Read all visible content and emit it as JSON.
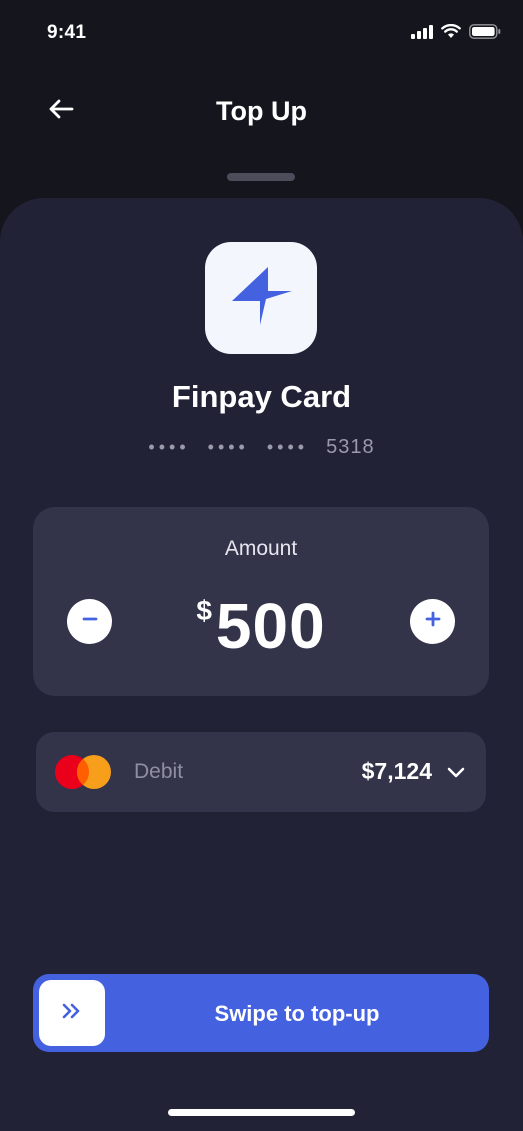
{
  "status_bar": {
    "time": "9:41",
    "icons": [
      "cellular-signal-icon",
      "wifi-icon",
      "battery-icon"
    ]
  },
  "header": {
    "title": "Top Up",
    "back_icon": "arrow-left-icon"
  },
  "card": {
    "name": "Finpay Card",
    "masked_groups": [
      "••••",
      "••••",
      "••••"
    ],
    "last_four": "5318",
    "logo_icon": "four-point-star-icon"
  },
  "amount": {
    "label": "Amount",
    "currency": "$",
    "value": "500",
    "decrement_icon": "minus-icon",
    "increment_icon": "plus-icon"
  },
  "source": {
    "label": "Debit",
    "balance": "$7,124",
    "brand_icon": "mastercard-icon",
    "dropdown_icon": "chevron-down-icon"
  },
  "swipe": {
    "label": "Swipe to top-up",
    "handle_icon": "double-chevron-right-icon"
  },
  "colors": {
    "background": "#15151e",
    "sheet": "#222236",
    "panel": "#33334a",
    "accent": "#4461e0",
    "muted_text": "#9a9aaa",
    "mastercard_red": "#eb001b",
    "mastercard_orange": "#f79e1b"
  }
}
